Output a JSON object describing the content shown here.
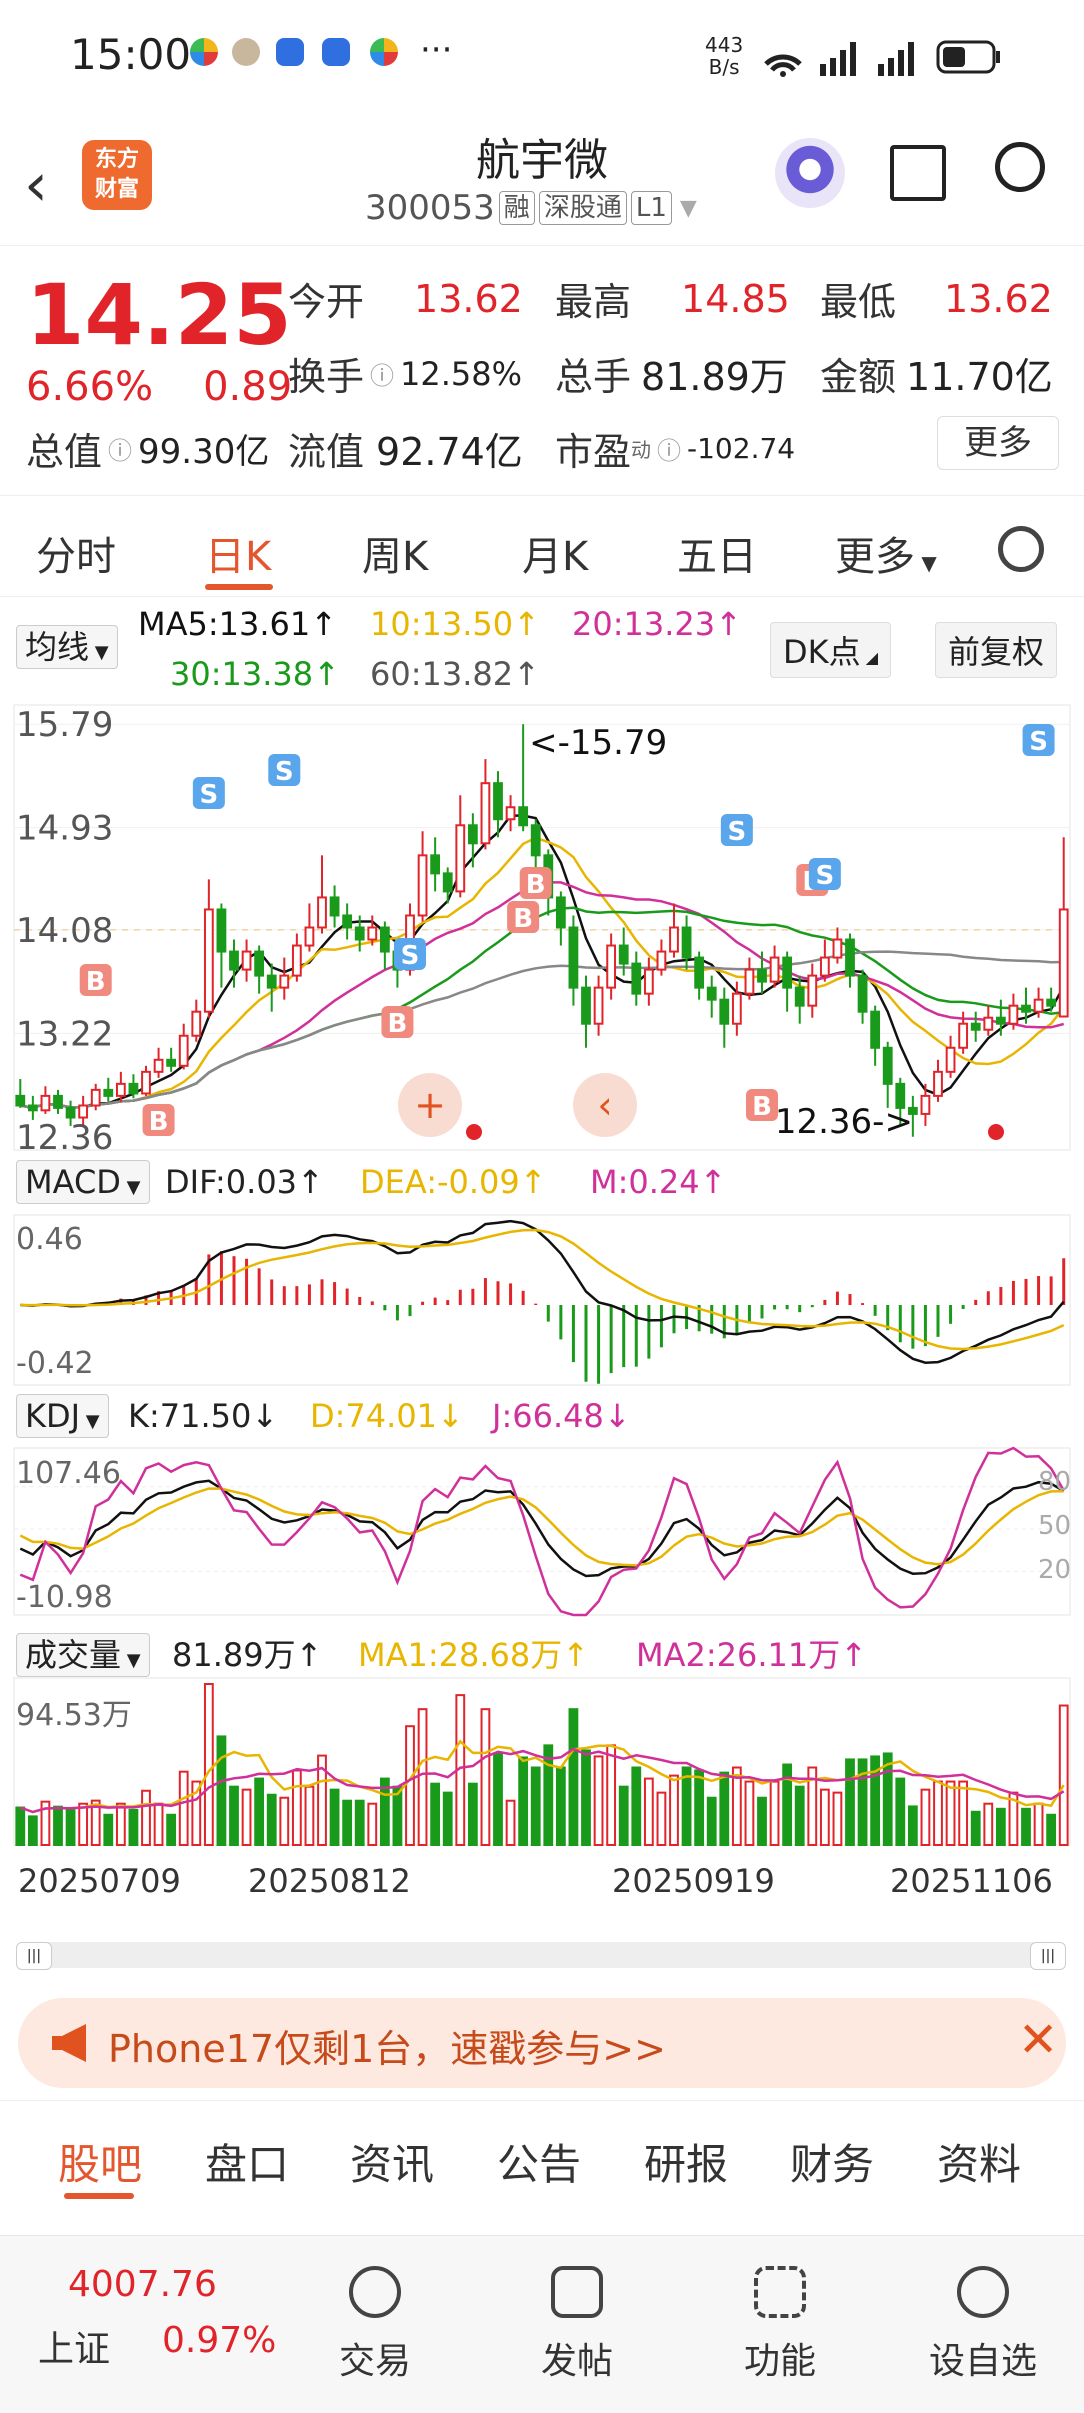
{
  "status_bar": {
    "time": "15:00",
    "net_speed_top": "443",
    "net_speed_bottom": "B/s",
    "dots": "···"
  },
  "nav": {
    "back_icon": "chevron-left-icon",
    "logo_line1": "东方",
    "logo_line2": "财富",
    "name": "航宇微",
    "code": "300053",
    "tags": [
      "融",
      "深股通",
      "L1"
    ]
  },
  "quote": {
    "price": "14.25",
    "change_pct": "6.66%",
    "change_abs": "0.89",
    "open_label": "今开",
    "open": "13.62",
    "high_label": "最高",
    "high": "14.85",
    "low_label": "最低",
    "low": "13.62",
    "turnover_label": "换手",
    "turnover": "12.58%",
    "volume_label": "总手",
    "volume": "81.89万",
    "amount_label": "金额",
    "amount": "11.70亿",
    "mcap_label": "总值",
    "mcap": "99.30亿",
    "float_label": "流值",
    "float": "92.74亿",
    "pe_label": "市盈",
    "pe_sup": "动",
    "pe": "-102.74",
    "more": "更多"
  },
  "ktabs": [
    "分时",
    "日K",
    "周K",
    "月K",
    "五日",
    "更多"
  ],
  "ma_row": {
    "label": "均线",
    "ma5": "MA5:13.61↑",
    "ma10": "10:13.50↑",
    "ma20": "20:13.23↑",
    "ma30": "30:13.38↑",
    "ma60": "60:13.82↑",
    "dk": "DK点",
    "fq": "前复权"
  },
  "kline": {
    "y_labels": [
      "15.79",
      "14.93",
      "14.08",
      "13.22",
      "12.36"
    ],
    "high_note": "<-15.79",
    "low_note": "12.36->",
    "dashed_level": 14.08
  },
  "macd": {
    "label": "MACD",
    "dif": "DIF:0.03↑",
    "dea": "DEA:-0.09↑",
    "m": "M:0.24↑",
    "y_top": "0.46",
    "y_bottom": "-0.42"
  },
  "kdj": {
    "label": "KDJ",
    "k": "K:71.50↓",
    "d": "D:74.01↓",
    "j": "J:66.48↓",
    "y_top": "107.46",
    "y_bottom": "-10.98",
    "ref": [
      "80",
      "50",
      "20"
    ]
  },
  "vol": {
    "label": "成交量",
    "v": "81.89万↑",
    "ma1": "MA1:28.68万↑",
    "ma2": "MA2:26.11万↑",
    "y_top": "94.53万",
    "dates": [
      "20250709",
      "20250812",
      "20250919",
      "20251106"
    ]
  },
  "ad": {
    "text": "Phone17仅剩1台，速戳参与>>"
  },
  "bottom_tabs": [
    "股吧",
    "盘口",
    "资讯",
    "公告",
    "研报",
    "财务",
    "资料"
  ],
  "footer": {
    "index_value": "4007.76",
    "index_name": "上证",
    "index_change": "0.97%",
    "items": [
      "交易",
      "发帖",
      "功能",
      "设自选"
    ]
  },
  "colors": {
    "up": "#e0242a",
    "down": "#1a9a1a",
    "accent": "#e4572e",
    "ma5": "#111111",
    "ma10": "#e8b500",
    "ma20": "#d0309a",
    "ma30": "#1a9a1a",
    "ma60": "#888888"
  },
  "chart_data": {
    "type": "candlestick",
    "candles": [
      [
        12.7,
        12.62,
        12.84,
        12.6
      ],
      [
        12.62,
        12.58,
        12.7,
        12.5
      ],
      [
        12.58,
        12.7,
        12.78,
        12.55
      ],
      [
        12.7,
        12.6,
        12.75,
        12.55
      ],
      [
        12.6,
        12.52,
        12.66,
        12.45
      ],
      [
        12.52,
        12.62,
        12.7,
        12.45
      ],
      [
        12.62,
        12.75,
        12.8,
        12.58
      ],
      [
        12.75,
        12.7,
        12.85,
        12.65
      ],
      [
        12.7,
        12.8,
        12.9,
        12.65
      ],
      [
        12.8,
        12.72,
        12.88,
        12.68
      ],
      [
        12.72,
        12.9,
        12.95,
        12.7
      ],
      [
        12.9,
        13.0,
        13.1,
        12.85
      ],
      [
        13.0,
        12.95,
        13.1,
        12.9
      ],
      [
        12.95,
        13.2,
        13.3,
        12.92
      ],
      [
        13.2,
        13.4,
        13.5,
        13.15
      ],
      [
        13.4,
        14.25,
        14.5,
        13.35
      ],
      [
        14.25,
        13.9,
        14.3,
        13.6
      ],
      [
        13.9,
        13.75,
        14.0,
        13.6
      ],
      [
        13.75,
        13.9,
        14.0,
        13.65
      ],
      [
        13.9,
        13.7,
        13.95,
        13.55
      ],
      [
        13.7,
        13.6,
        13.8,
        13.4
      ],
      [
        13.6,
        13.7,
        13.85,
        13.5
      ],
      [
        13.7,
        13.95,
        14.05,
        13.65
      ],
      [
        13.95,
        14.1,
        14.3,
        13.9
      ],
      [
        14.1,
        14.35,
        14.7,
        14.05
      ],
      [
        14.35,
        14.2,
        14.45,
        14.1
      ],
      [
        14.2,
        14.1,
        14.3,
        14.0
      ],
      [
        14.1,
        14.0,
        14.2,
        13.9
      ],
      [
        14.0,
        14.1,
        14.2,
        13.95
      ],
      [
        14.1,
        13.9,
        14.15,
        13.75
      ],
      [
        13.9,
        13.75,
        14.0,
        13.6
      ],
      [
        13.75,
        14.2,
        14.3,
        13.7
      ],
      [
        14.2,
        14.7,
        14.9,
        14.15
      ],
      [
        14.7,
        14.55,
        14.85,
        14.4
      ],
      [
        14.55,
        14.4,
        14.6,
        14.3
      ],
      [
        14.4,
        14.95,
        15.2,
        14.35
      ],
      [
        14.95,
        14.8,
        15.05,
        14.6
      ],
      [
        14.8,
        15.3,
        15.5,
        14.75
      ],
      [
        15.3,
        15.0,
        15.4,
        14.85
      ],
      [
        15.0,
        15.1,
        15.2,
        14.9
      ],
      [
        15.1,
        14.95,
        15.79,
        14.9
      ],
      [
        14.95,
        14.7,
        15.0,
        14.55
      ],
      [
        14.7,
        14.35,
        14.75,
        14.2
      ],
      [
        14.35,
        14.1,
        14.4,
        13.95
      ],
      [
        14.1,
        13.6,
        14.2,
        13.45
      ],
      [
        13.6,
        13.3,
        13.7,
        13.1
      ],
      [
        13.3,
        13.6,
        13.7,
        13.2
      ],
      [
        13.6,
        13.95,
        14.05,
        13.5
      ],
      [
        13.95,
        13.8,
        14.1,
        13.7
      ],
      [
        13.8,
        13.55,
        13.9,
        13.45
      ],
      [
        13.55,
        13.75,
        13.85,
        13.45
      ],
      [
        13.75,
        13.9,
        14.0,
        13.7
      ],
      [
        13.9,
        14.1,
        14.3,
        13.85
      ],
      [
        14.1,
        13.85,
        14.2,
        13.75
      ],
      [
        13.85,
        13.6,
        13.9,
        13.5
      ],
      [
        13.6,
        13.5,
        13.7,
        13.35
      ],
      [
        13.5,
        13.3,
        13.6,
        13.1
      ],
      [
        13.3,
        13.55,
        13.65,
        13.2
      ],
      [
        13.55,
        13.75,
        13.85,
        13.5
      ],
      [
        13.75,
        13.65,
        13.9,
        13.55
      ],
      [
        13.65,
        13.85,
        13.95,
        13.6
      ],
      [
        13.85,
        13.6,
        13.9,
        13.4
      ],
      [
        13.6,
        13.45,
        13.7,
        13.3
      ],
      [
        13.45,
        13.7,
        13.8,
        13.35
      ],
      [
        13.7,
        13.85,
        14.0,
        13.65
      ],
      [
        13.85,
        14.0,
        14.1,
        13.8
      ],
      [
        14.0,
        13.7,
        14.05,
        13.6
      ],
      [
        13.7,
        13.4,
        13.75,
        13.3
      ],
      [
        13.4,
        13.1,
        13.45,
        12.95
      ],
      [
        13.1,
        12.8,
        13.15,
        12.6
      ],
      [
        12.8,
        12.6,
        12.85,
        12.45
      ],
      [
        12.6,
        12.55,
        12.7,
        12.36
      ],
      [
        12.55,
        12.7,
        12.8,
        12.45
      ],
      [
        12.7,
        12.9,
        13.0,
        12.65
      ],
      [
        12.9,
        13.1,
        13.2,
        12.85
      ],
      [
        13.1,
        13.3,
        13.4,
        13.05
      ],
      [
        13.3,
        13.25,
        13.4,
        13.15
      ],
      [
        13.25,
        13.35,
        13.45,
        13.2
      ],
      [
        13.35,
        13.3,
        13.5,
        13.2
      ],
      [
        13.3,
        13.45,
        13.55,
        13.25
      ],
      [
        13.45,
        13.4,
        13.6,
        13.3
      ],
      [
        13.4,
        13.5,
        13.6,
        13.35
      ],
      [
        13.5,
        13.45,
        13.6,
        13.4
      ],
      [
        13.36,
        14.25,
        14.85,
        13.62
      ]
    ]
  }
}
